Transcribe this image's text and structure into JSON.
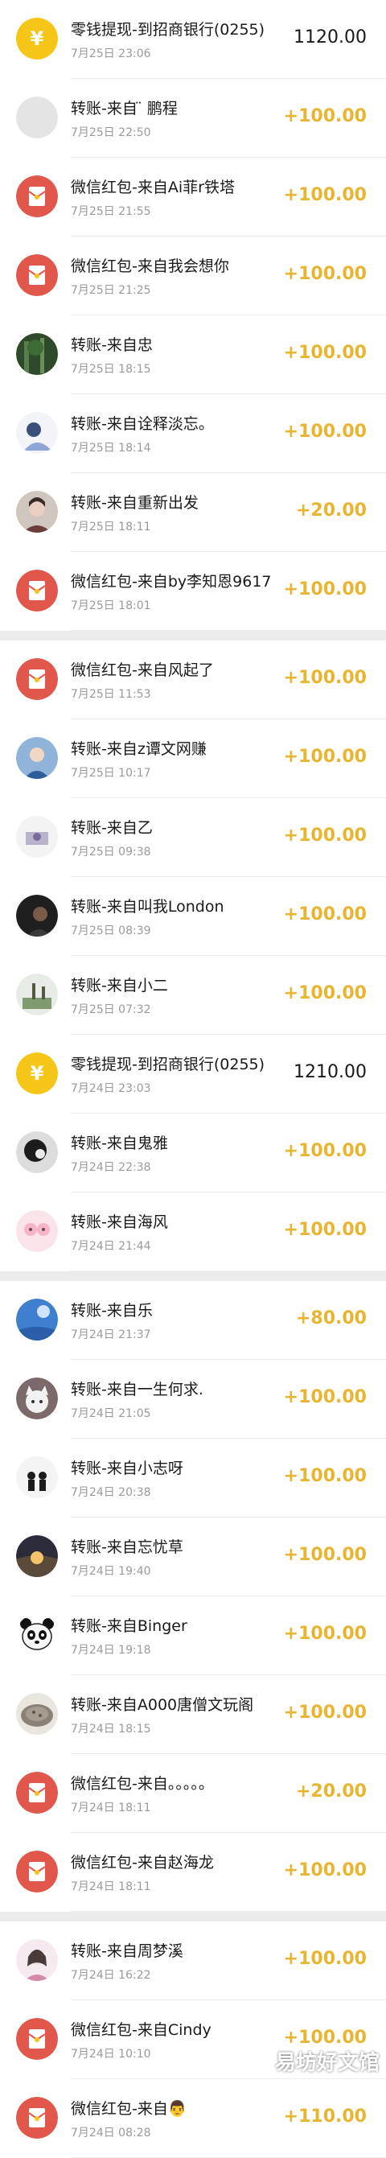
{
  "colors": {
    "income": "#e8b531",
    "red_packet": "#e2574c",
    "coin": "#f5c518",
    "divider": "#ececec",
    "section_gap": "#ebebeb"
  },
  "transactions": [
    {
      "title": "零钱提现-到招商银行(0255)",
      "time": "7月25日 23:06",
      "amount": "1120.00",
      "kind": "withdraw",
      "icon": "coin-icon"
    },
    {
      "title": "转账-来自 ̈ 鹏程",
      "time": "7月25日 22:50",
      "amount": "+100.00",
      "kind": "income",
      "icon": "avatar-grey"
    },
    {
      "title": "微信红包-来自Ai菲r铁塔",
      "time": "7月25日 21:55",
      "amount": "+100.00",
      "kind": "income",
      "icon": "red-packet-icon"
    },
    {
      "title": "微信红包-来自我会想你",
      "time": "7月25日 21:25",
      "amount": "+100.00",
      "kind": "income",
      "icon": "red-packet-icon"
    },
    {
      "title": "转账-来自忠",
      "time": "7月25日 18:15",
      "amount": "+100.00",
      "kind": "income",
      "icon": "avatar-forest"
    },
    {
      "title": "转账-来自诠释淡忘。",
      "time": "7月25日 18:14",
      "amount": "+100.00",
      "kind": "income",
      "icon": "avatar-girl"
    },
    {
      "title": "转账-来自重新出发",
      "time": "7月25日 18:11",
      "amount": "+20.00",
      "kind": "income",
      "icon": "avatar-portrait"
    },
    {
      "title": "微信红包-来自by李知恩9617",
      "time": "7月25日 18:01",
      "amount": "+100.00",
      "kind": "income",
      "icon": "red-packet-icon"
    },
    {
      "title": "微信红包-来自风起了",
      "time": "7月25日 11:53",
      "amount": "+100.00",
      "kind": "income",
      "icon": "red-packet-icon"
    },
    {
      "title": "转账-来自z谭文网赚",
      "time": "7月25日 10:17",
      "amount": "+100.00",
      "kind": "income",
      "icon": "avatar-blue"
    },
    {
      "title": "转账-来自乙",
      "time": "7月25日 09:38",
      "amount": "+100.00",
      "kind": "income",
      "icon": "avatar-square"
    },
    {
      "title": "转账-来自叫我London",
      "time": "7月25日 08:39",
      "amount": "+100.00",
      "kind": "income",
      "icon": "avatar-dark"
    },
    {
      "title": "转账-来自小二",
      "time": "7月25日 07:32",
      "amount": "+100.00",
      "kind": "income",
      "icon": "avatar-scene"
    },
    {
      "title": "零钱提现-到招商银行(0255)",
      "time": "7月24日 23:03",
      "amount": "1210.00",
      "kind": "withdraw",
      "icon": "coin-icon"
    },
    {
      "title": "转账-来自鬼雅",
      "time": "7月24日 22:38",
      "amount": "+100.00",
      "kind": "income",
      "icon": "avatar-bw"
    },
    {
      "title": "转账-来自海风",
      "time": "7月24日 21:44",
      "amount": "+100.00",
      "kind": "income",
      "icon": "avatar-pink"
    },
    {
      "title": "转账-来自乐",
      "time": "7月24日 21:37",
      "amount": "+80.00",
      "kind": "income",
      "icon": "avatar-sky"
    },
    {
      "title": "转账-来自一生何求.",
      "time": "7月24日 21:05",
      "amount": "+100.00",
      "kind": "income",
      "icon": "avatar-cat"
    },
    {
      "title": "转账-来自小志呀",
      "time": "7月24日 20:38",
      "amount": "+100.00",
      "kind": "income",
      "icon": "avatar-couple"
    },
    {
      "title": "转账-来自忘忧草",
      "time": "7月24日 19:40",
      "amount": "+100.00",
      "kind": "income",
      "icon": "avatar-sunset"
    },
    {
      "title": "转账-来自Binger",
      "time": "7月24日 19:18",
      "amount": "+100.00",
      "kind": "income",
      "icon": "avatar-panda"
    },
    {
      "title": "转账-来自A000唐僧文玩阁",
      "time": "7月24日 18:15",
      "amount": "+100.00",
      "kind": "income",
      "icon": "avatar-stone"
    },
    {
      "title": "微信红包-来自。。。。。",
      "time": "7月24日 18:11",
      "amount": "+20.00",
      "kind": "income",
      "icon": "red-packet-icon"
    },
    {
      "title": "微信红包-来自赵海龙",
      "time": "7月24日 18:11",
      "amount": "+100.00",
      "kind": "income",
      "icon": "red-packet-icon"
    },
    {
      "title": "转账-来自周梦溪",
      "time": "7月24日 16:22",
      "amount": "+100.00",
      "kind": "income",
      "icon": "avatar-girl2"
    },
    {
      "title": "微信红包-来自Cindy",
      "time": "7月24日 10:10",
      "amount": "+100.00",
      "kind": "income",
      "icon": "red-packet-icon"
    },
    {
      "title": "微信红包-来自👨",
      "time": "7月24日 08:28",
      "amount": "+110.00",
      "kind": "income",
      "icon": "red-packet-icon"
    }
  ],
  "watermark": "易坊好文馆"
}
